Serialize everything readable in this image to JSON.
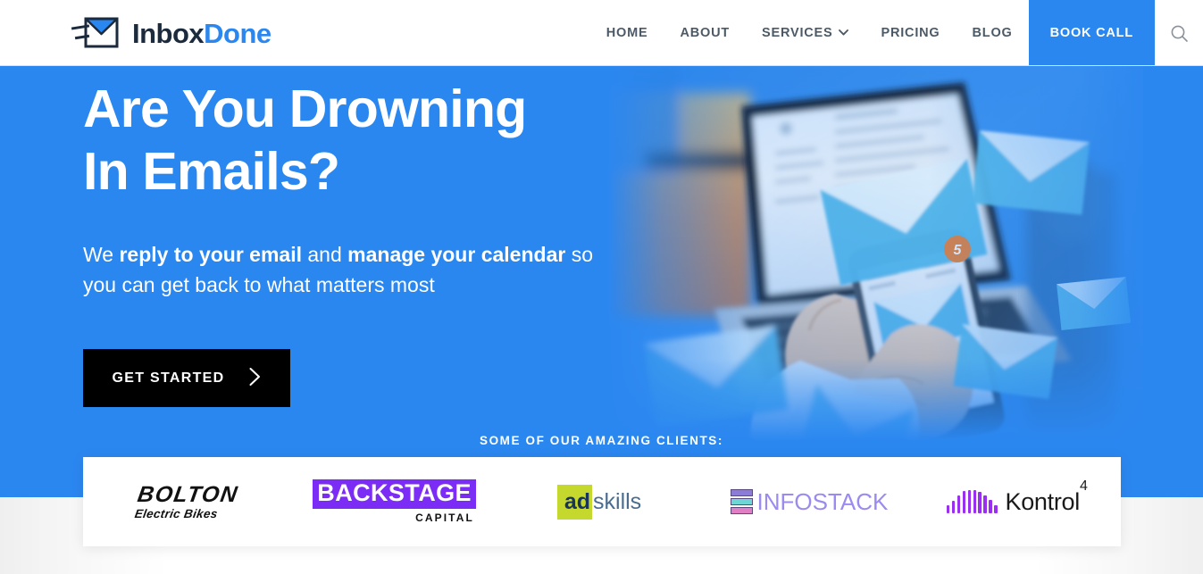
{
  "brand": {
    "logo_icon": "envelope-send-icon",
    "name_part1": "Inbox",
    "name_part2": "Done",
    "color_primary": "#2b87f0",
    "color_dark": "#1b2a3d"
  },
  "nav": {
    "items": [
      {
        "label": "HOME",
        "name": "home",
        "has_caret": false,
        "highlight": false
      },
      {
        "label": "ABOUT",
        "name": "about",
        "has_caret": false,
        "highlight": false
      },
      {
        "label": "SERVICES",
        "name": "services",
        "has_caret": true,
        "caret": "❯",
        "highlight": false
      },
      {
        "label": "PRICING",
        "name": "pricing",
        "has_caret": false,
        "highlight": false
      },
      {
        "label": "BLOG",
        "name": "blog",
        "has_caret": false,
        "highlight": false
      },
      {
        "label": "BOOK CALL",
        "name": "book-call",
        "has_caret": false,
        "highlight": true
      }
    ],
    "search_icon": "search-icon"
  },
  "hero": {
    "title_line1": "Are You Drowning",
    "title_line2": "In Emails?",
    "sub_pre": "We ",
    "sub_bold1": "reply to your email",
    "sub_mid": " and ",
    "sub_bold2": "manage your calendar",
    "sub_post": " so you can get back to what matters most",
    "cta_label": "GET STARTED",
    "cta_chevron": "›",
    "background_color": "#2b87f0",
    "image_alt": "hands-holding-phone-with-laptop-and-floating-envelopes",
    "phone_badge": "5"
  },
  "clients": {
    "heading": "SOME OF OUR AMAZING CLIENTS:",
    "logos": [
      {
        "name": "bolton-electric-bikes",
        "line1": "BOLTON",
        "line2": "Electric Bikes"
      },
      {
        "name": "backstage-capital",
        "line1": "BACKSTAGE",
        "line2": "CAPITAL"
      },
      {
        "name": "adskills",
        "part1": "ad",
        "part2": "skills"
      },
      {
        "name": "infostack",
        "text": "INFOSTACK"
      },
      {
        "name": "kontrol4",
        "text": "Kontrol",
        "sup": "4"
      }
    ]
  }
}
